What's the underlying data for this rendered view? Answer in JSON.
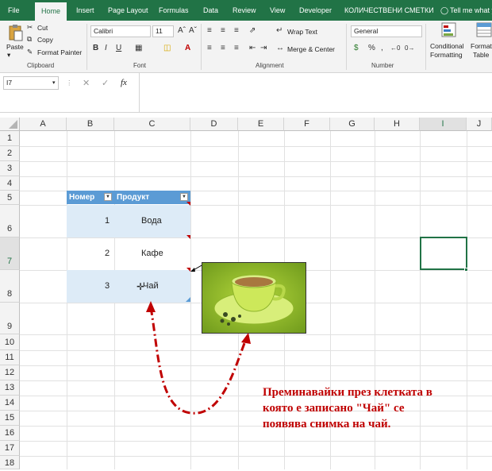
{
  "tabs": [
    "File",
    "Home",
    "Insert",
    "Page Layout",
    "Formulas",
    "Data",
    "Review",
    "View",
    "Developer",
    "КОЛИЧЕСТВЕНИ СМЕТКИ",
    "Tell me what y"
  ],
  "clipboard": {
    "paste": "Paste",
    "cut": "Cut",
    "copy": "Copy",
    "painter": "Format Painter",
    "label": "Clipboard"
  },
  "font": {
    "name": "Calibri",
    "size": "11",
    "bold": "B",
    "italic": "I",
    "underline": "U",
    "label": "Font"
  },
  "alignment": {
    "wrap": "Wrap Text",
    "merge": "Merge & Center",
    "label": "Alignment"
  },
  "number": {
    "format": "General",
    "label": "Number"
  },
  "styles": {
    "conditional": "Conditional",
    "formatting": "Formatting",
    "format_as": "Format as",
    "table": "Table"
  },
  "formula_bar": {
    "name_box": "I7",
    "fx": "fx",
    "content": ""
  },
  "columns": [
    "A",
    "B",
    "C",
    "D",
    "E",
    "F",
    "G",
    "H",
    "I",
    "J"
  ],
  "rows": [
    "1",
    "2",
    "3",
    "4",
    "5",
    "6",
    "7",
    "8",
    "9",
    "10",
    "11",
    "12",
    "13",
    "14",
    "15",
    "16",
    "17",
    "18"
  ],
  "table": {
    "headers": [
      "Номер",
      "Продукт"
    ],
    "rows": [
      [
        "1",
        "Вода"
      ],
      [
        "2",
        "Кафе"
      ],
      [
        "3",
        "Чай"
      ]
    ]
  },
  "annotation": "Преминавайки през клетката в която е записано \"Чай\" се появява снимка на чай.",
  "colors": {
    "excel_green": "#217346",
    "table_header": "#5b9bd5",
    "table_band": "#ddebf7",
    "arrow": "#c00000"
  }
}
